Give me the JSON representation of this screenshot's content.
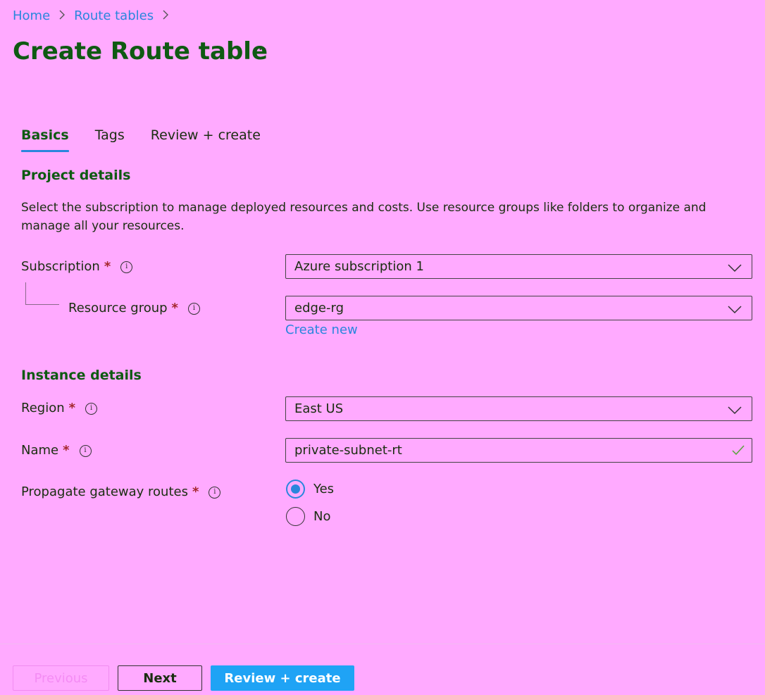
{
  "breadcrumb": {
    "items": [
      "Home",
      "Route tables"
    ]
  },
  "header": {
    "title": "Create Route table",
    "more": "···"
  },
  "tabs": [
    {
      "label": "Basics",
      "active": true
    },
    {
      "label": "Tags",
      "active": false
    },
    {
      "label": "Review + create",
      "active": false
    }
  ],
  "project": {
    "title": "Project details",
    "description": "Select the subscription to manage deployed resources and costs. Use resource groups like folders to organize and manage all your resources.",
    "subscription_label": "Subscription",
    "subscription_value": "Azure subscription 1",
    "resource_group_label": "Resource group",
    "resource_group_value": "edge-rg",
    "create_new": "Create new"
  },
  "instance": {
    "title": "Instance details",
    "region_label": "Region",
    "region_value": "East US",
    "name_label": "Name",
    "name_value": "private-subnet-rt",
    "propagate_label": "Propagate gateway routes",
    "options": [
      "Yes",
      "No"
    ],
    "selected": "Yes"
  },
  "required_marker": "*",
  "footer": {
    "previous": "Previous",
    "next": "Next",
    "review_create": "Review + create"
  },
  "colors": {
    "background": "#ffaaff",
    "accent": "#2a86dd",
    "title": "#0e5a12",
    "primary_button": "#1fa3f5"
  }
}
